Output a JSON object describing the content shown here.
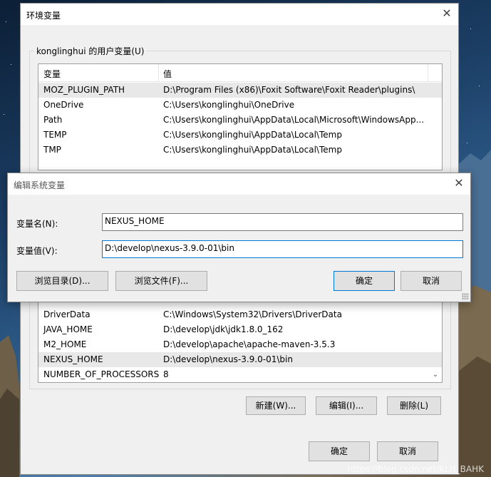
{
  "main_dialog": {
    "title": "环境变量",
    "user_group_label": "konglinghui 的用户变量(U)",
    "user_vars": {
      "col_name": "变量",
      "col_value": "值",
      "rows": [
        {
          "name": "MOZ_PLUGIN_PATH",
          "value": "D:\\Program Files (x86)\\Foxit Software\\Foxit Reader\\plugins\\"
        },
        {
          "name": "OneDrive",
          "value": "C:\\Users\\konglinghui\\OneDrive"
        },
        {
          "name": "Path",
          "value": "C:\\Users\\konglinghui\\AppData\\Local\\Microsoft\\WindowsApp..."
        },
        {
          "name": "TEMP",
          "value": "C:\\Users\\konglinghui\\AppData\\Local\\Temp"
        },
        {
          "name": "TMP",
          "value": "C:\\Users\\konglinghui\\AppData\\Local\\Temp"
        }
      ]
    },
    "system_vars": {
      "rows": [
        {
          "name": "DriverData",
          "value": "C:\\Windows\\System32\\Drivers\\DriverData"
        },
        {
          "name": "JAVA_HOME",
          "value": "D:\\develop\\jdk\\jdk1.8.0_162"
        },
        {
          "name": "M2_HOME",
          "value": "D:\\develop\\apache\\apache-maven-3.5.3"
        },
        {
          "name": "NEXUS_HOME",
          "value": "D:\\develop\\nexus-3.9.0-01\\bin"
        },
        {
          "name": "NUMBER_OF_PROCESSORS",
          "value": "8"
        }
      ]
    },
    "system_buttons": {
      "new": "新建(W)...",
      "edit": "编辑(I)...",
      "delete": "删除(L)"
    },
    "ok": "确定",
    "cancel": "取消"
  },
  "edit_dialog": {
    "title": "编辑系统变量",
    "name_label": "变量名(N):",
    "value_label": "变量值(V):",
    "name_value": "NEXUS_HOME",
    "value_value": "D:\\develop\\nexus-3.9.0-01\\bin",
    "browse_dir": "浏览目录(D)...",
    "browse_file": "浏览文件(F)...",
    "ok": "确定",
    "cancel": "取消"
  },
  "watermark": "https://blog.csdn.net/KLH_BAHK"
}
